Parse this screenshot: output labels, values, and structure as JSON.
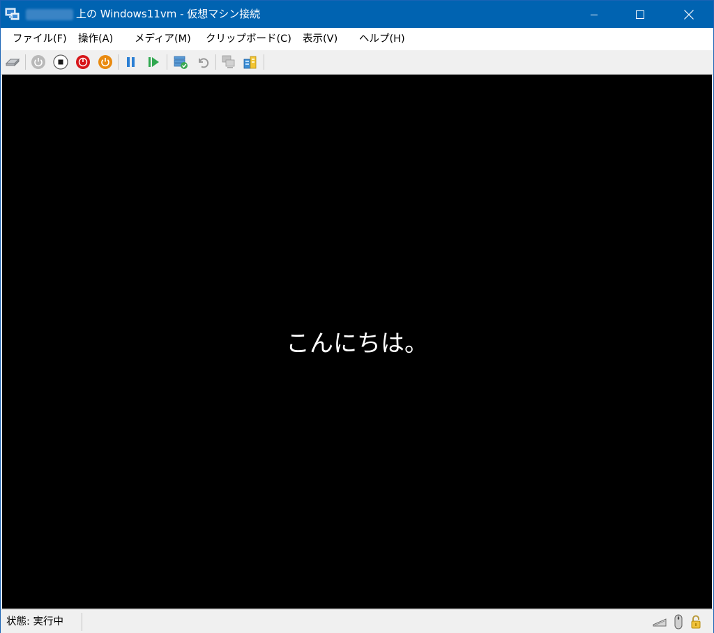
{
  "window": {
    "title": "上の Windows11vm  - 仮想マシン接続",
    "titlebar_color": "#0063b1"
  },
  "menu": {
    "items": [
      {
        "label": "ファイル(F)"
      },
      {
        "label": "操作(A)"
      },
      {
        "label": "メディア(M)"
      },
      {
        "label": "クリップボード(C)"
      },
      {
        "label": "表示(V)"
      },
      {
        "label": "ヘルプ(H)"
      }
    ]
  },
  "toolbar": {
    "buttons": [
      {
        "icon": "ctrl-alt-del-icon"
      },
      {
        "icon": "start-icon"
      },
      {
        "icon": "turn-off-icon"
      },
      {
        "icon": "shut-down-icon"
      },
      {
        "icon": "save-icon"
      },
      {
        "icon": "pause-icon"
      },
      {
        "icon": "resume-icon"
      },
      {
        "icon": "checkpoint-icon"
      },
      {
        "icon": "revert-icon"
      },
      {
        "icon": "enhanced-session-icon"
      },
      {
        "icon": "share-icon"
      }
    ]
  },
  "vm": {
    "greeting": "こんにちは。"
  },
  "status": {
    "text": "状態: 実行中",
    "icons": [
      "keyboard-icon",
      "mouse-icon",
      "lock-icon"
    ]
  }
}
